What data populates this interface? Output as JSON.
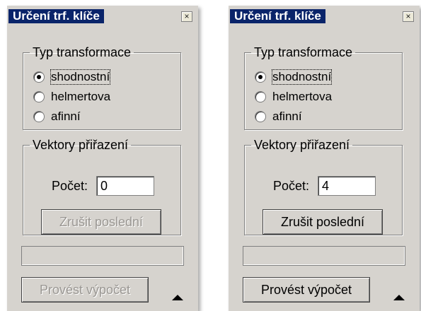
{
  "dialogs": [
    {
      "title": "Určení trf. klíče",
      "close_symbol": "×",
      "transform_group": {
        "legend": "Typ transformace",
        "options": [
          "shodnostní",
          "helmertova",
          "afinní"
        ],
        "selected": 0
      },
      "vectors_group": {
        "legend": "Vektory přiřazení",
        "count_label": "Počet:",
        "count_value": "0",
        "cancel_label": "Zrušit poslední",
        "cancel_enabled": false
      },
      "status_text": "",
      "compute_label": "Provést výpočet",
      "compute_enabled": false,
      "collapse_icon": "up-arrow-icon"
    },
    {
      "title": "Určení trf. klíče",
      "close_symbol": "×",
      "transform_group": {
        "legend": "Typ transformace",
        "options": [
          "shodnostní",
          "helmertova",
          "afinní"
        ],
        "selected": 0
      },
      "vectors_group": {
        "legend": "Vektory přiřazení",
        "count_label": "Počet:",
        "count_value": "4",
        "cancel_label": "Zrušit poslední",
        "cancel_enabled": true
      },
      "status_text": "",
      "compute_label": "Provést výpočet",
      "compute_enabled": true,
      "collapse_icon": "up-arrow-icon"
    }
  ]
}
